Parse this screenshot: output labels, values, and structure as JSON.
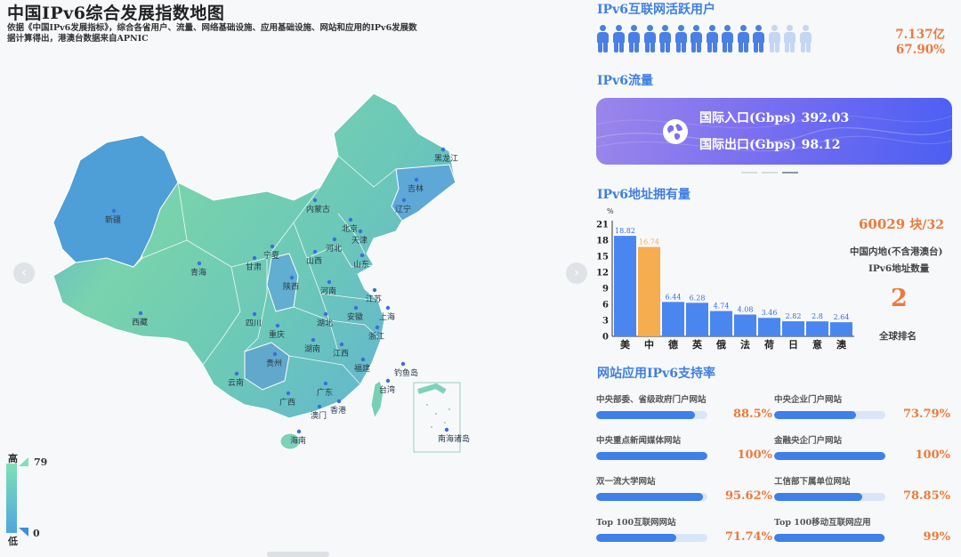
{
  "map": {
    "title": "中国IPv6综合发展指数地图",
    "description": "依据《中国IPv6发展指标》，综合各省用户、流量、网络基础设施、应用基础设施、网站和应用的IPv6发展数据计算得出，港澳台数据来自APNIC",
    "legend": {
      "high_label": "高",
      "low_label": "低",
      "max": "79",
      "min": "0"
    },
    "colors": {
      "high": "#7fe0b6",
      "low": "#3f8de0"
    },
    "nav_prev": "‹",
    "nav_next": "›",
    "provinces": [
      "新疆",
      "西藏",
      "青海",
      "甘肃",
      "宁夏",
      "内蒙古",
      "黑龙江",
      "吉林",
      "辽宁",
      "北京",
      "天津",
      "河北",
      "山西",
      "陕西",
      "山东",
      "河南",
      "江苏",
      "安徽",
      "上海",
      "四川",
      "湖北",
      "重庆",
      "浙江",
      "湖南",
      "江西",
      "贵州",
      "云南",
      "福建",
      "钓鱼岛",
      "台湾",
      "广西",
      "广东",
      "香港",
      "澳门",
      "海南",
      "南海诸岛"
    ]
  },
  "active_users": {
    "title": "IPv6互联网活跃用户",
    "value": "7.137亿",
    "percent": "67.90%",
    "ratio": 0.679,
    "icon_count": 14
  },
  "traffic": {
    "title": "IPv6流量",
    "inbound_label": "国际入口(Gbps)",
    "inbound_value": "392.03",
    "outbound_label": "国际出口(Gbps)",
    "outbound_value": "98.12",
    "icon": "globe-icon",
    "card_colors": [
      "#9b86ea",
      "#4b5ff3"
    ]
  },
  "address": {
    "title": "IPv6地址拥有量",
    "total": "60029",
    "unit": "块/32",
    "caption_line1": "中国内地(不含港澳台)",
    "caption_line2": "IPv6地址数量",
    "rank": "2",
    "rank_caption": "全球排名"
  },
  "chart_data": {
    "type": "bar",
    "title": "",
    "ylabel": "%",
    "xlabel": "",
    "categories": [
      "美",
      "中",
      "德",
      "英",
      "俄",
      "法",
      "荷",
      "日",
      "意",
      "澳"
    ],
    "values": [
      18.82,
      16.74,
      6.44,
      6.28,
      4.74,
      4.08,
      3.46,
      2.82,
      2.8,
      2.64
    ],
    "value_labels": [
      "18.82",
      "16.74",
      "6.44",
      "6.28",
      "4.74",
      "4.08",
      "3.46",
      "2.82",
      "2.8",
      "2.64"
    ],
    "yticks": [
      0,
      3,
      6,
      9,
      12,
      15,
      18,
      21
    ],
    "ylim": [
      0,
      21
    ],
    "grid": false,
    "bar_color": "#4a86f0",
    "highlight_color": "#f5ad4f",
    "highlight_index": 1
  },
  "support": {
    "title": "网站应用IPv6支持率",
    "items": [
      {
        "label": "中央部委、省级政府门户网站",
        "value": "88.5%",
        "ratio": 0.885
      },
      {
        "label": "中央企业门户网站",
        "value": "73.79%",
        "ratio": 0.7379
      },
      {
        "label": "中央重点新闻媒体网站",
        "value": "100%",
        "ratio": 1.0
      },
      {
        "label": "金融央企门户网站",
        "value": "100%",
        "ratio": 1.0
      },
      {
        "label": "双一流大学网站",
        "value": "95.62%",
        "ratio": 0.9562
      },
      {
        "label": "工信部下属单位网站",
        "value": "78.85%",
        "ratio": 0.7885
      },
      {
        "label": "Top 100互联网网站",
        "value": "71.74%",
        "ratio": 0.7174
      },
      {
        "label": "Top 100移动互联网应用",
        "value": "99%",
        "ratio": 0.99
      }
    ]
  }
}
